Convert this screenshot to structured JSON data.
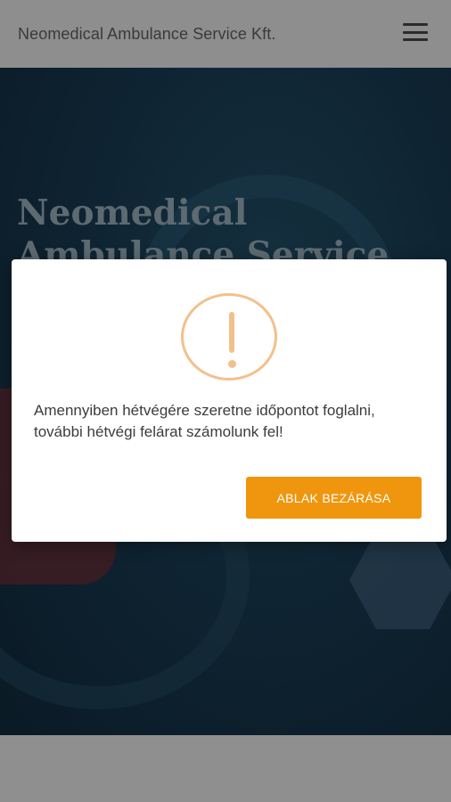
{
  "header": {
    "brand": "Neomedical Ambulance Service Kft.",
    "menu_icon": "hamburger-menu-icon"
  },
  "hero": {
    "title": "Neomedical Ambulance Service"
  },
  "modal": {
    "icon": "warning-exclamation-icon",
    "message": "Amennyiben hétvégére szeretne időpontot foglalni, további hétvégi felárat számolunk fel!",
    "close_label": "ABLAK BEZÁRÁSA"
  },
  "colors": {
    "accent": "#f0960e",
    "warning_icon": "#f3c08c",
    "hero_bg": "#0e2230"
  }
}
